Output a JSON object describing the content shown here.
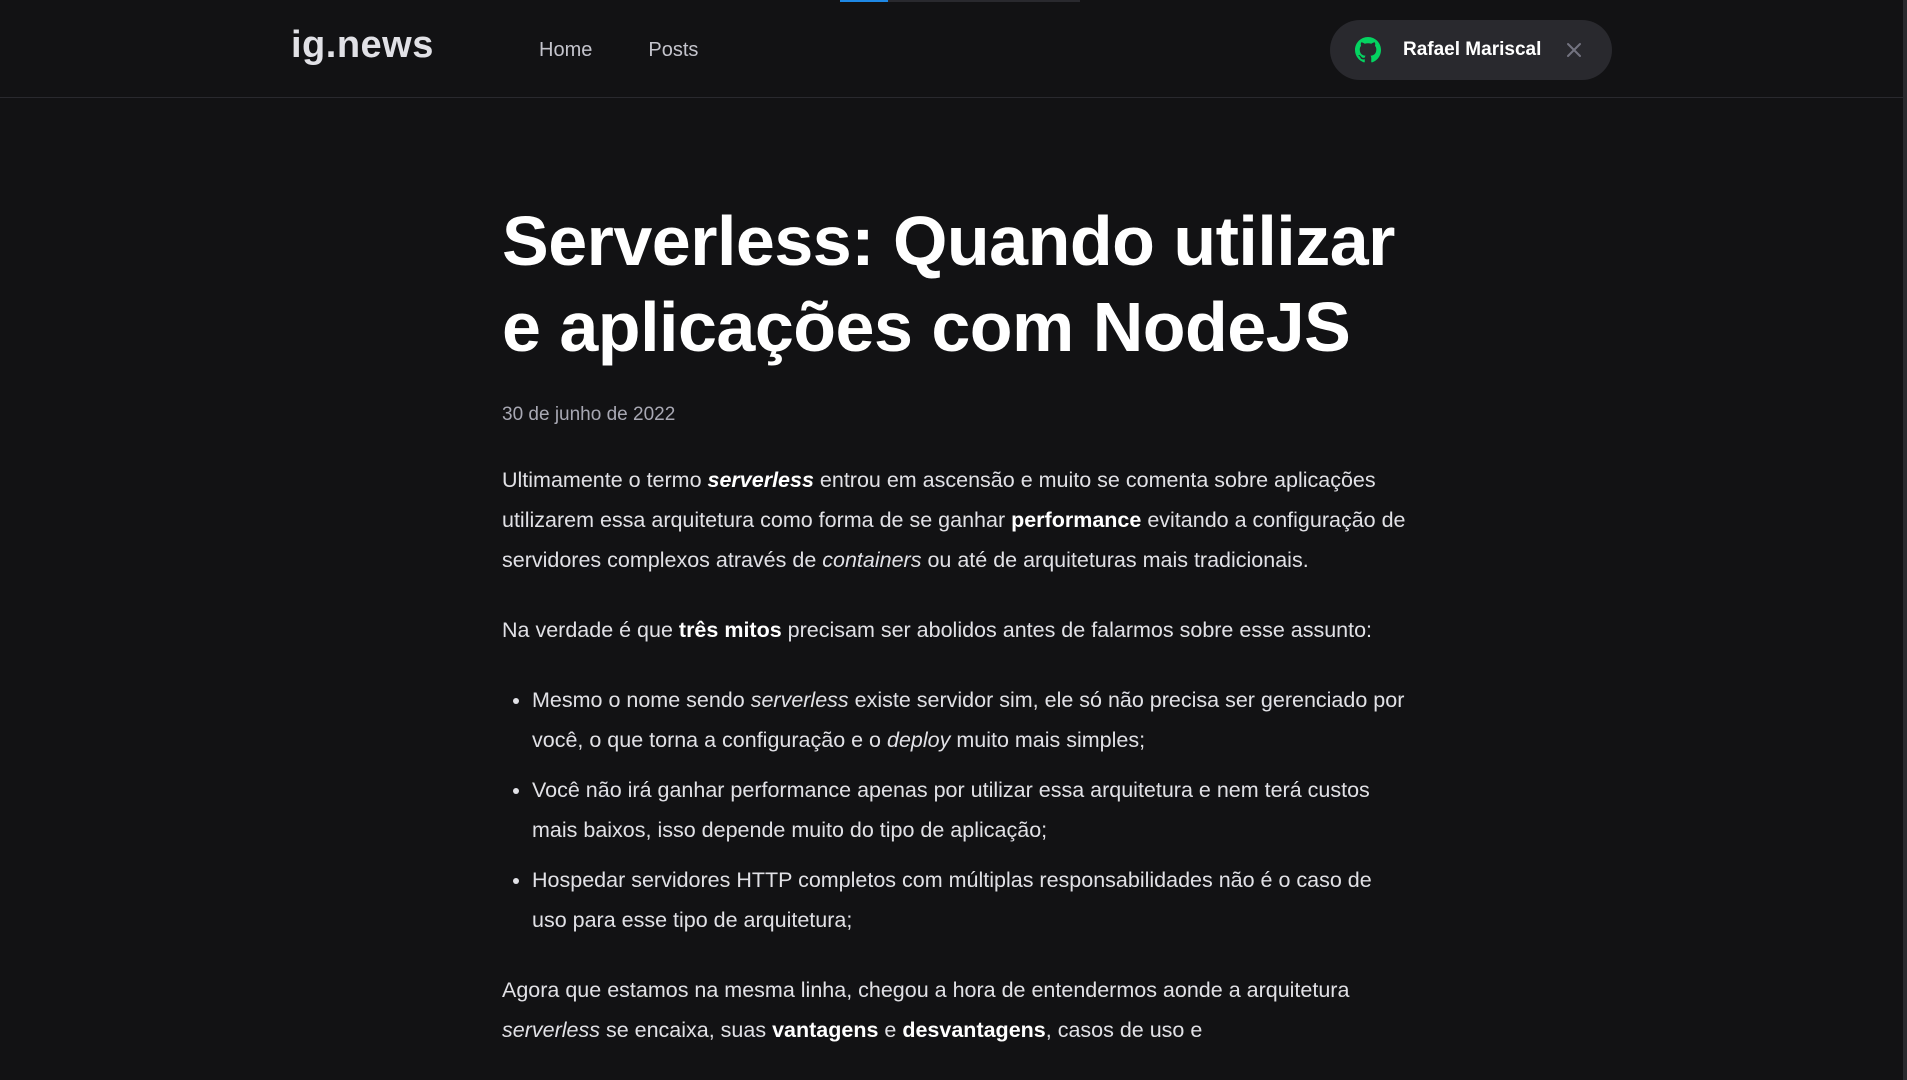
{
  "header": {
    "logo": "ig.news",
    "nav": [
      {
        "label": "Home"
      },
      {
        "label": "Posts"
      }
    ],
    "user": {
      "name": "Rafael Mariscal",
      "icon": "github-icon",
      "icon_color": "#04d361"
    }
  },
  "post": {
    "title": "Serverless: Quando utilizar e aplicações com NodeJS",
    "date": "30 de junho de 2022",
    "p1": {
      "a": "Ultimamente o termo ",
      "b": "serverless",
      "c": " entrou em ascensão e muito se comenta sobre aplicações utilizarem essa arquitetura como forma de se ganhar ",
      "d": "performance",
      "e": " evitando a configuração de servidores complexos através de ",
      "f": "containers",
      "g": " ou até de arquiteturas mais tradicionais."
    },
    "p2": {
      "a": "Na verdade é que ",
      "b": "três mitos",
      "c": " precisam ser abolidos antes de falarmos sobre esse assunto:"
    },
    "list": [
      {
        "a": "Mesmo o nome sendo ",
        "b": "serverless",
        "c": " existe servidor sim, ele só não precisa ser gerenciado por você, o que torna a configuração e o ",
        "d": "deploy",
        "e": " muito mais simples;"
      },
      {
        "a": "Você não irá ganhar performance apenas por utilizar essa arquitetura e nem terá custos mais baixos, isso depende muito do tipo de aplicação;"
      },
      {
        "a": "Hospedar servidores HTTP completos com múltiplas responsabilidades não é o caso de uso para esse tipo de arquitetura;"
      }
    ],
    "p3": {
      "a": "Agora que estamos na mesma linha, chegou a hora de entendermos aonde a arquitetura ",
      "b": "serverless",
      "c": " se encaixa, suas ",
      "d": "vantagens",
      "e": " e ",
      "f": "desvantagens",
      "g": ", casos de uso e"
    }
  },
  "colors": {
    "background": "#121214",
    "text": "#e1e1e6",
    "accent": "#1e88e5"
  }
}
